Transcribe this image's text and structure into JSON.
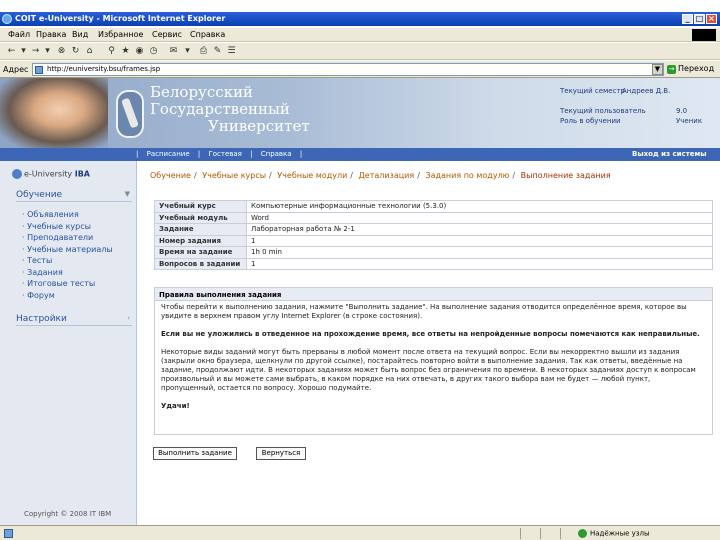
{
  "window": {
    "title": "COIT e-University - Microsoft Internet Explorer",
    "controls": [
      "_",
      "□",
      "×"
    ]
  },
  "menubar": [
    "Файл",
    "Правка",
    "Вид",
    "Избранное",
    "Сервис",
    "Справка"
  ],
  "toolbar_icons": [
    "back-icon",
    "forward-icon",
    "stop-icon",
    "refresh-icon",
    "home-icon",
    "search-icon",
    "favorites-icon",
    "media-icon",
    "history-icon",
    "mail-icon",
    "print-icon",
    "edit-icon",
    "discuss-icon"
  ],
  "address": {
    "label": "Адрес",
    "url": "http://euniversity.bsu/frames.jsp",
    "go_label": "Переход"
  },
  "banner": {
    "university_lines": [
      "Белорусский",
      "Государственный",
      "Университет"
    ],
    "user_info": [
      {
        "label": "Текущий семестр",
        "value": "Андреев Д.В."
      },
      {
        "label": "",
        "value": ""
      },
      {
        "label": "Текущий пользователь",
        "value": "9.0"
      },
      {
        "label": "Роль в обучении",
        "value": "Ученик"
      }
    ]
  },
  "navbar": {
    "links": [
      "Расписание",
      "Гостевая",
      "Справка"
    ],
    "separator": "|",
    "exit_label": "Выход из системы"
  },
  "sidebar": {
    "logo_text": "e-University",
    "logo_brand": "IBA",
    "section1": "Обучение",
    "items": [
      "Объявления",
      "Учебные курсы",
      "Преподаватели",
      "Учебные материалы",
      "Тесты",
      "Задания",
      "Итоговые тесты",
      "Форум"
    ],
    "section2": "Настройки",
    "copyright": "Copyright © 2008 IT IBM"
  },
  "breadcrumb": [
    "Обучение",
    "Учебные курсы",
    "Учебные модули",
    "Детализация",
    "Задания по модулю",
    "Выполнение задания"
  ],
  "info_table": [
    {
      "key": "Учебный курс",
      "value": "Компьютерные информационные технологии (5.3.0)"
    },
    {
      "key": "Учебный модуль",
      "value": "Word"
    },
    {
      "key": "Задание",
      "value": "Лабораторная работа № 2-1"
    },
    {
      "key": "Номер задания",
      "value": "1"
    },
    {
      "key": "Время на задание",
      "value": "1h 0 min"
    },
    {
      "key": "Вопросов в задании",
      "value": "1"
    }
  ],
  "rules": {
    "title": "Правила выполнения задания",
    "p1": "Чтобы перейти к выполнению задания, нажмите \"Выполнить задание\". На выполнение задания отводится определённое время, которое вы увидите в верхнем правом углу Internet Explorer (в строке состояния).",
    "p2": "Если вы не уложились в отведенное на прохождение время, все ответы на непройденные вопросы помечаются как неправильные.",
    "p3": "Некоторые виды заданий могут быть прерваны в любой момент после ответа на текущий вопрос. Если вы некорректно вышли из задания (закрыли окно браузера, щелкнули по другой ссылке), постарайтесь повторно войти в выполнение задания. Так как ответы, введённые на задание, продолжают идти. В некоторых заданиях может быть вопрос без ограничения по времени. В некоторых заданиях доступ к вопросам произвольный и вы можете сами выбрать, в каком порядке на них отвечать, в других такого выбора вам не будет — любой пункт, пропущенный, остается по вопросу. Хорошо подумайте.",
    "wish": "Удачи!"
  },
  "buttons": {
    "start": "Выполнить задание",
    "back": "Вернуться"
  },
  "statusbar": {
    "zone": "Надёжные узлы"
  }
}
